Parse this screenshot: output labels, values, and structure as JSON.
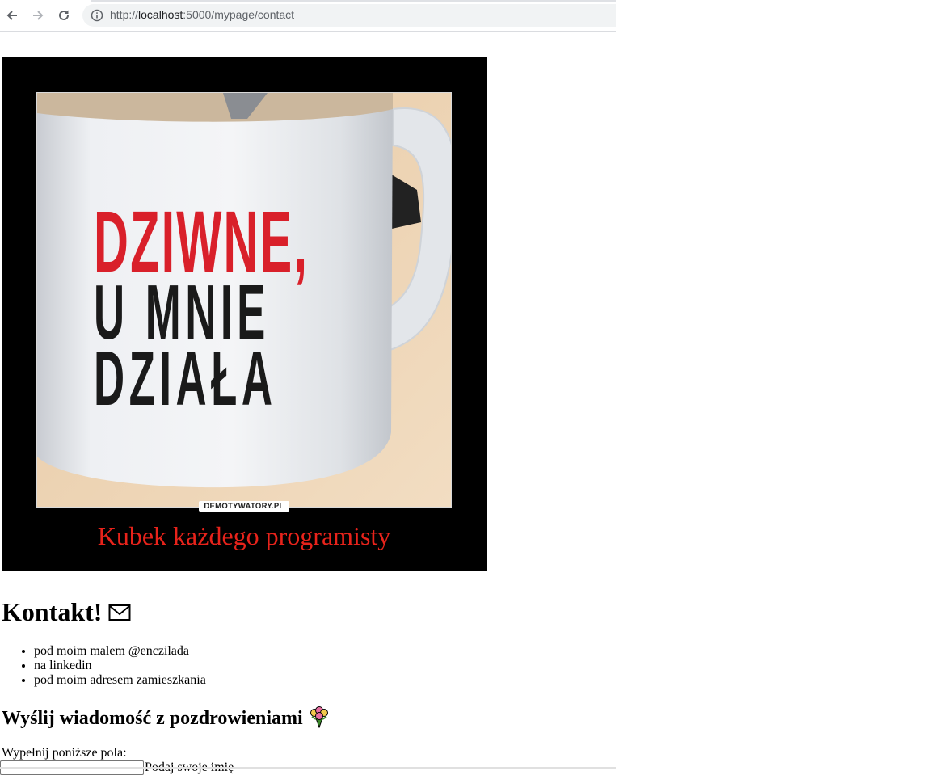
{
  "browser": {
    "url_scheme": "http://",
    "url_host": "localhost",
    "url_rest": ":5000/mypage/contact",
    "back_icon": "arrow-left-icon",
    "forward_icon": "arrow-right-icon",
    "reload_icon": "reload-icon",
    "site_info_icon": "info-circle-icon"
  },
  "image": {
    "mug_line1": "DZIWNE,",
    "mug_line2": "U MNIE",
    "mug_line3": "DZIAŁA",
    "watermark": "DEMOTYWATORY.PL",
    "caption": "Kubek każdego programisty",
    "caption_color": "#e8231b",
    "mug_red": "#d9202a"
  },
  "contact": {
    "title": "Kontakt!",
    "title_icon": "envelope-icon",
    "items": [
      "pod moim malem @enczilada",
      "na linkedin",
      "pod moim adresem zamieszkania"
    ]
  },
  "message": {
    "title": "Wyślij wiadomość z pozdrowieniami",
    "title_icon": "flower-bouquet-icon",
    "instructions": "Wypełnij poniższe pola:",
    "name_label": "Podaj swoje imię"
  }
}
